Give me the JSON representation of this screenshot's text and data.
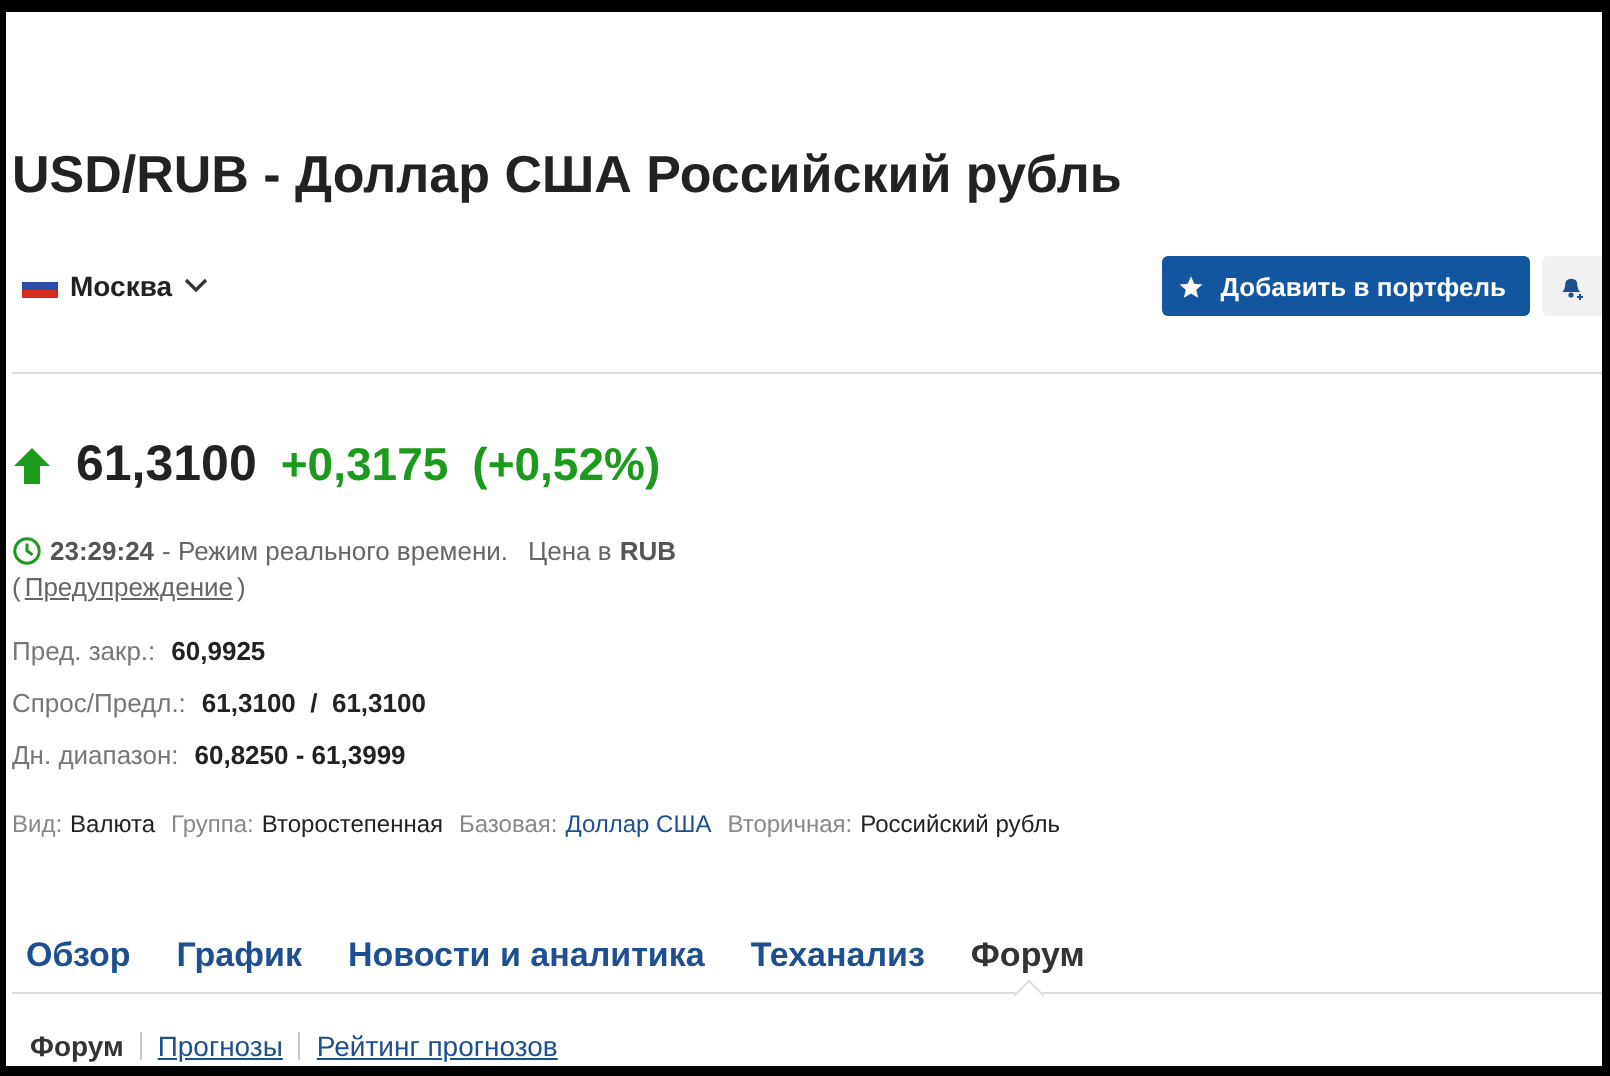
{
  "title": "USD/RUB - Доллар США Российский рубль",
  "location": {
    "label": "Москва"
  },
  "add_button": {
    "label": "Добавить в портфель"
  },
  "quote": {
    "rising": true,
    "price": "61,3100",
    "change": "+0,3175",
    "change_pct": "(+0,52%)"
  },
  "status": {
    "time": "23:29:24",
    "mode": "- Режим реального времени.",
    "currency_label": "Цена в",
    "currency": "RUB",
    "warning_open": "(",
    "warning_link": "Предупреждение",
    "warning_close": ")"
  },
  "stats": [
    {
      "label": "Пред. закр.:",
      "value": "60,9925"
    },
    {
      "label": "Спрос/Предл.:",
      "value": "61,3100  /  61,3100"
    },
    {
      "label": "Дн. диапазон:",
      "value": "60,8250 - 61,3999"
    }
  ],
  "info": [
    {
      "label": "Вид:",
      "value": "Валюта",
      "kind": "text"
    },
    {
      "label": "Группа:",
      "value": "Второстепенная",
      "kind": "text"
    },
    {
      "label": "Базовая:",
      "value": "Доллар США",
      "kind": "link"
    },
    {
      "label": "Вторичная:",
      "value": "Российский рубль",
      "kind": "text"
    }
  ],
  "tabs": [
    {
      "label": "Обзор",
      "selected": false
    },
    {
      "label": "График",
      "selected": false
    },
    {
      "label": "Новости и аналитика",
      "selected": false
    },
    {
      "label": "Теханализ",
      "selected": false
    },
    {
      "label": "Форум",
      "selected": true
    }
  ],
  "subtabs": [
    {
      "label": "Форум",
      "selected": true
    },
    {
      "label": "Прогнозы",
      "selected": false
    },
    {
      "label": "Рейтинг прогнозов",
      "selected": false
    }
  ]
}
